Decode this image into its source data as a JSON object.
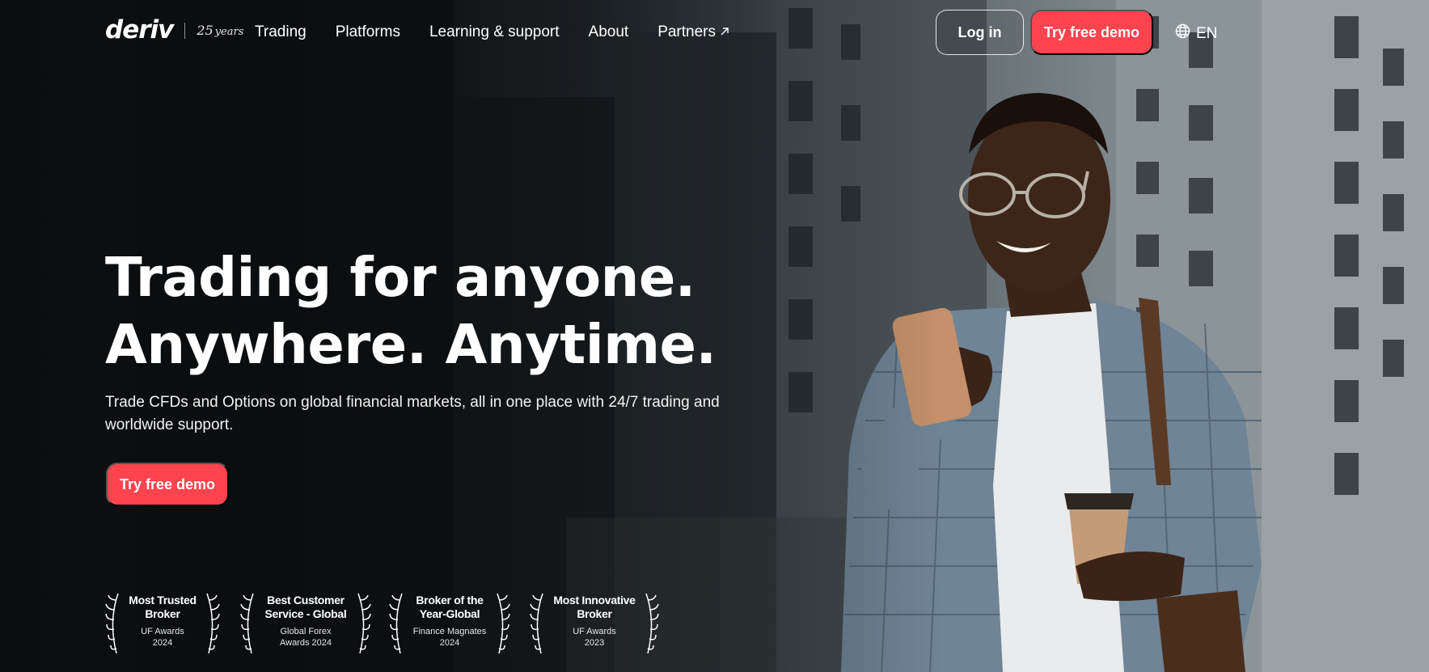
{
  "header": {
    "logo": {
      "wordmark": "deriv",
      "years_number": "25",
      "years_label": "years"
    },
    "nav": [
      {
        "label": "Trading"
      },
      {
        "label": "Platforms"
      },
      {
        "label": "Learning & support"
      },
      {
        "label": "About"
      },
      {
        "label": "Partners",
        "icon": "external-arrow-icon"
      }
    ],
    "login_label": "Log in",
    "demo_label": "Try free demo",
    "language": {
      "label": "EN",
      "icon": "globe-icon"
    }
  },
  "hero": {
    "title_line1": "Trading for anyone.",
    "title_line2": "Anywhere. Anytime.",
    "subtitle_line1": "Trade CFDs and Options on global financial markets, all in one place with 24/7 trading and",
    "subtitle_line2": "worldwide support.",
    "cta_label": "Try free demo"
  },
  "awards": [
    {
      "name_line1": "Most Trusted",
      "name_line2": "Broker",
      "org_line1": "UF Awards",
      "org_line2": "2024"
    },
    {
      "name_line1": "Best Customer",
      "name_line2": "Service - Global",
      "org_line1": "Global Forex",
      "org_line2": "Awards 2024"
    },
    {
      "name_line1": "Broker of the",
      "name_line2": "Year-Global",
      "org_line1": "Finance Magnates",
      "org_line2": "2024"
    },
    {
      "name_line1": "Most Innovative",
      "name_line2": "Broker",
      "org_line1": "UF Awards",
      "org_line2": "2023"
    }
  ],
  "colors": {
    "brand_red": "#ff444f",
    "text_white": "#ffffff"
  }
}
